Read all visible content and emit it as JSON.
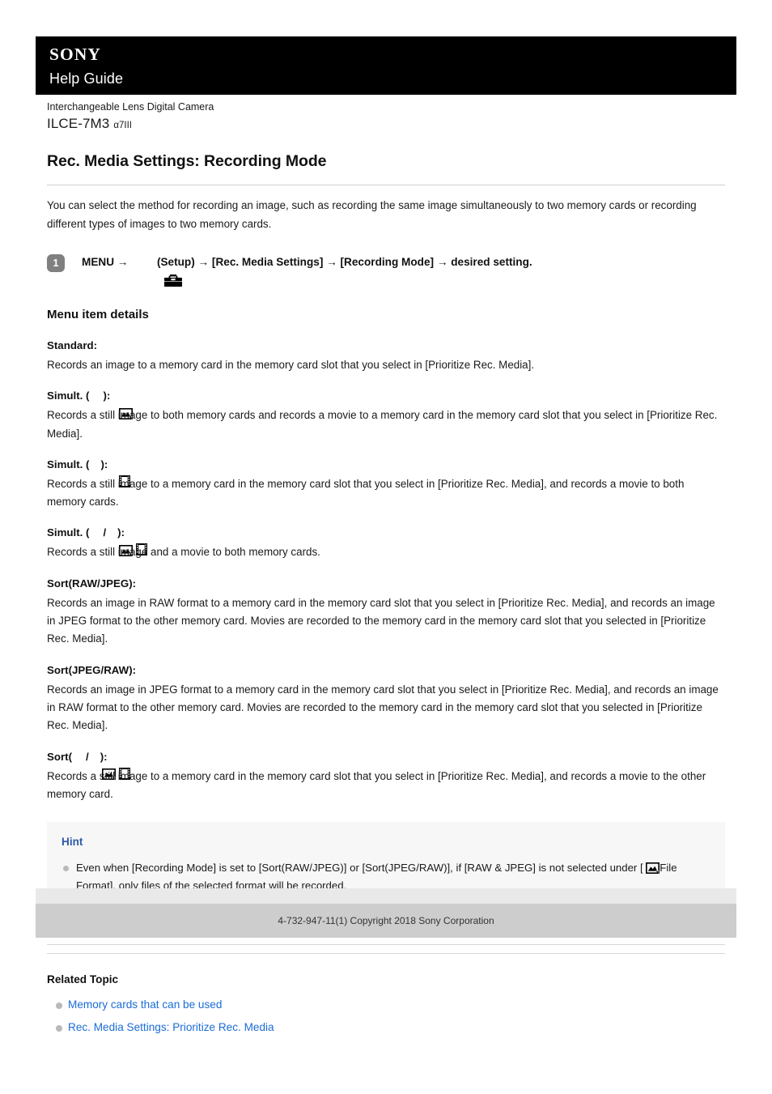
{
  "header": {
    "brand": "SONY",
    "subtitle": "Help Guide"
  },
  "model": {
    "category": "Interchangeable Lens Digital Camera",
    "name": "ILCE-7M3",
    "alias": "α7III"
  },
  "page": {
    "title": "Rec. Media Settings: Recording Mode",
    "intro": "You can select the method for recording an image, such as recording the same image simultaneously to two memory cards or recording different types of images to two memory cards."
  },
  "step": {
    "number": "1",
    "part1": "MENU → ",
    "icon": "toolbox-icon",
    "part2": " (Setup) → [Rec. Media Settings] → [Recording Mode] → desired setting."
  },
  "details": {
    "heading": "Menu item details",
    "items": [
      {
        "term_prefix": "Standard:",
        "term_suffix": "",
        "icons": [],
        "desc": "Records an image to a memory card in the memory card slot that you select in [Prioritize Rec. Media]."
      },
      {
        "term_prefix": "Simult. (",
        "term_mid": "",
        "term_suffix": "):",
        "icons": [
          "still-image-icon"
        ],
        "desc": "Records a still image to both memory cards and records a movie to a memory card in the memory card slot that you select in [Prioritize Rec. Media]."
      },
      {
        "term_prefix": "Simult. (",
        "term_mid": "",
        "term_suffix": "):",
        "icons": [
          "movie-icon"
        ],
        "desc": "Records a still image to a memory card in the memory card slot that you select in [Prioritize Rec. Media], and records a movie to both memory cards."
      },
      {
        "term_prefix": "Simult. (",
        "term_mid": "/",
        "term_suffix": "):",
        "icons": [
          "still-image-icon",
          "movie-icon"
        ],
        "desc": "Records a still image and a movie to both memory cards."
      },
      {
        "term_prefix": "Sort(RAW/JPEG):",
        "term_suffix": "",
        "icons": [],
        "desc": "Records an image in RAW format to a memory card in the memory card slot that you select in [Prioritize Rec. Media], and records an image in JPEG format to the other memory card. Movies are recorded to the memory card in the memory card slot that you selected in [Prioritize Rec. Media]."
      },
      {
        "term_prefix": "Sort(JPEG/RAW):",
        "term_suffix": "",
        "icons": [],
        "desc": "Records an image in JPEG format to a memory card in the memory card slot that you select in [Prioritize Rec. Media], and records an image in RAW format to the other memory card. Movies are recorded to the memory card in the memory card slot that you selected in [Prioritize Rec. Media]."
      },
      {
        "term_prefix": "Sort(",
        "term_mid": "/",
        "term_suffix": "):",
        "icons": [
          "still-image-icon",
          "movie-icon"
        ],
        "desc": "Records a still image to a memory card in the memory card slot that you select in [Prioritize Rec. Media], and records a movie to the other memory card."
      }
    ]
  },
  "hint": {
    "title": "Hint",
    "bullet_part1": "Even when [Recording Mode] is set to [Sort(RAW/JPEG)] or [Sort(JPEG/RAW)], if [RAW & JPEG] is not selected under [ ",
    "bullet_icon": "still-image-icon",
    "bullet_part2": "File Format], only files of the selected format will be recorded."
  },
  "related": {
    "heading": "Related Topic",
    "links": [
      "Memory cards that can be used",
      "Rec. Media Settings: Prioritize Rec. Media"
    ]
  },
  "footer": {
    "copyright": "4-732-947-11(1) Copyright 2018 Sony Corporation"
  },
  "colors": {
    "header_bg": "#000000",
    "link": "#1a6cd6",
    "hint_title": "#2e5aa8",
    "hint_bg": "#f7f7f7",
    "step_badge": "#808080",
    "footer_dark": "#cdcdcd",
    "footer_light": "#e9e9e9"
  }
}
